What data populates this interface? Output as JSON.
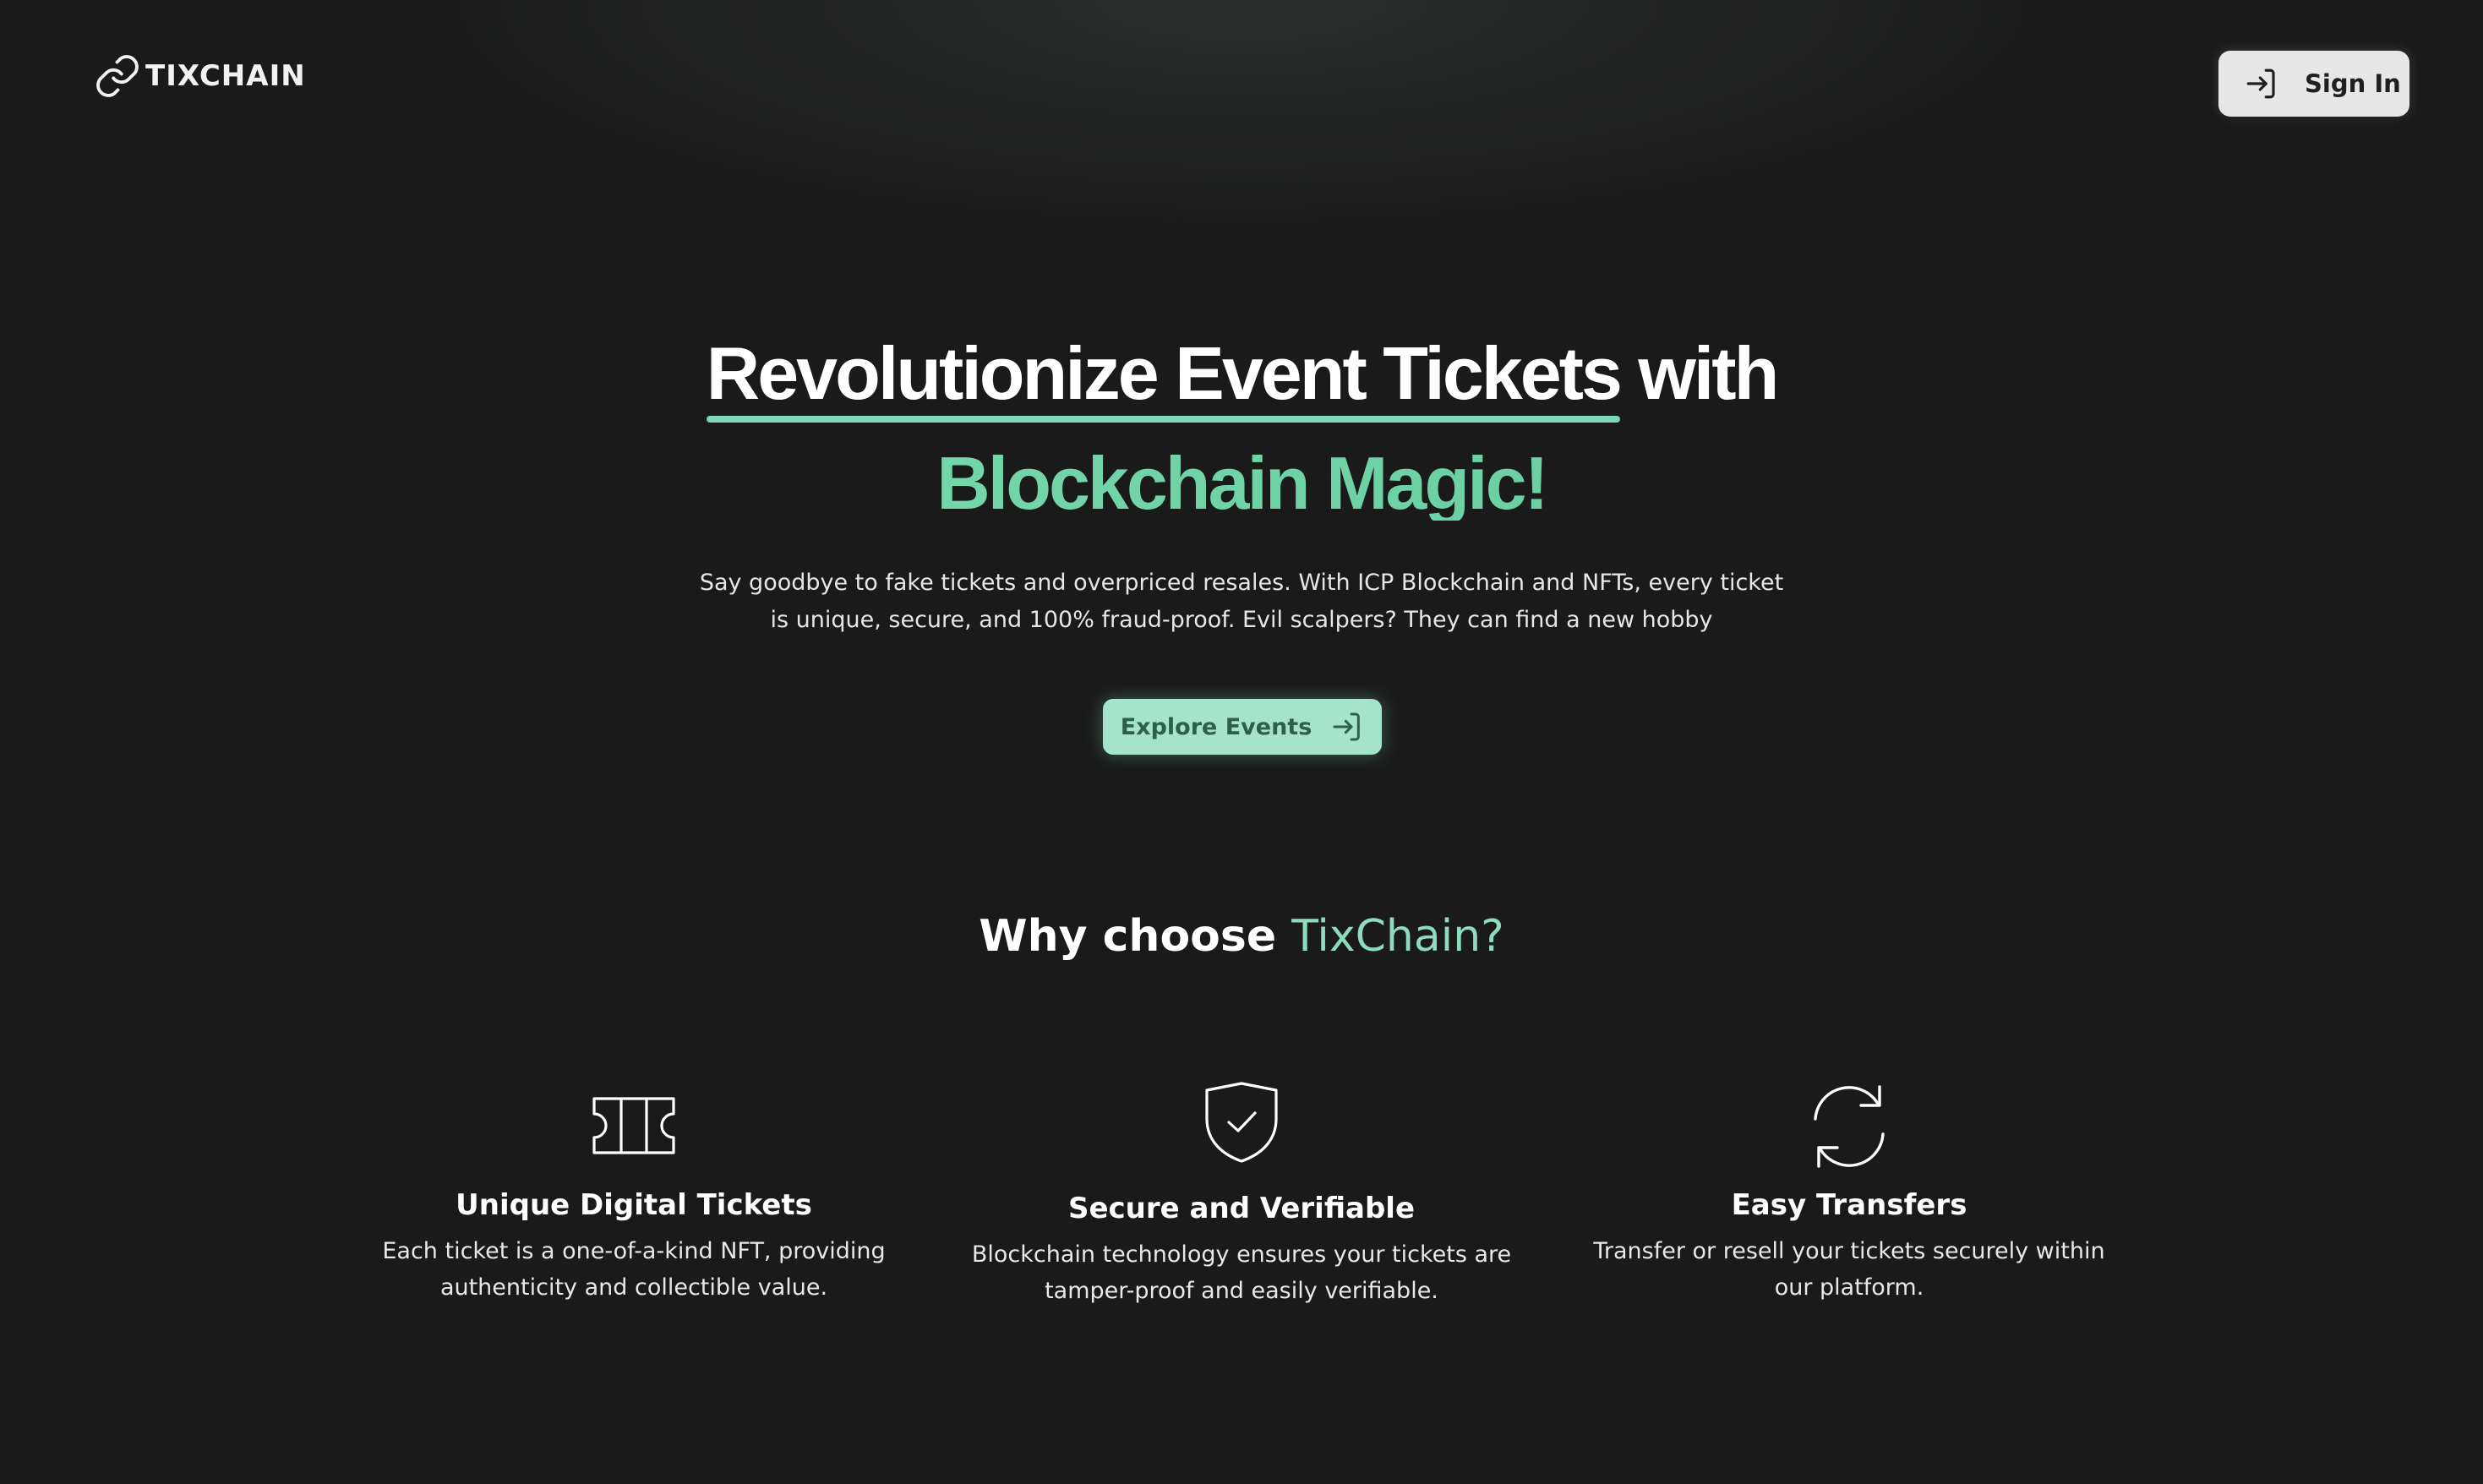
{
  "header": {
    "logo_text": "TIXCHAIN",
    "logo_icon": "chain-link-icon",
    "signin_label": "Sign In",
    "signin_icon": "sign-in-arrow-icon"
  },
  "hero": {
    "title_highlight": "Revolutionize Event Tickets",
    "title_rest": " with",
    "title_line2": "Blockchain Magic!",
    "description": "Say goodbye to fake tickets and overpriced resales. With ICP Blockchain and NFTs, every ticket is unique, secure, and 100% fraud-proof. Evil scalpers? They can find a new hobby",
    "cta_label": "Explore Events",
    "cta_icon": "sign-in-arrow-icon"
  },
  "why": {
    "prefix": "Why choose ",
    "accent": "TixChain?"
  },
  "features": [
    {
      "icon": "ticket-icon",
      "title": "Unique Digital Tickets",
      "description": "Each ticket is a one-of-a-kind NFT, providing authenticity and collectible value."
    },
    {
      "icon": "shield-check-icon",
      "title": "Secure and Verifiable",
      "description": "Blockchain technology ensures your tickets are tamper-proof and easily verifiable."
    },
    {
      "icon": "refresh-icon",
      "title": "Easy Transfers",
      "description": "Transfer or resell your tickets securely within our platform."
    }
  ],
  "colors": {
    "background": "#1a1a1a",
    "accent_green": "#74d1a8",
    "button_mint": "#a5e3cb",
    "signin_bg": "#e7e7e7"
  }
}
